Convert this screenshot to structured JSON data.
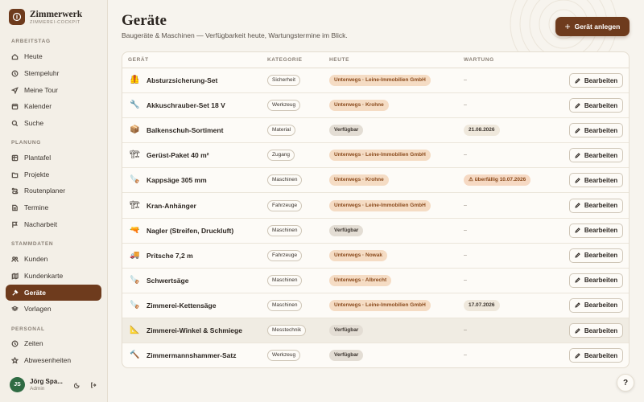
{
  "brand": {
    "name": "Zimmerwerk",
    "subtitle": "ZIMMEREI-COCKPIT"
  },
  "sidebar": {
    "sections": [
      "ARBEITSTAG",
      "PLANUNG",
      "STAMMDATEN",
      "PERSONAL"
    ],
    "items": [
      {
        "label": "Heute",
        "icon": "home-icon"
      },
      {
        "label": "Stempeluhr",
        "icon": "clock-icon"
      },
      {
        "label": "Meine Tour",
        "icon": "send-icon"
      },
      {
        "label": "Kalender",
        "icon": "calendar-icon"
      },
      {
        "label": "Suche",
        "icon": "search-icon"
      },
      {
        "label": "Plantafel",
        "icon": "grid-icon"
      },
      {
        "label": "Projekte",
        "icon": "folder-icon"
      },
      {
        "label": "Routenplaner",
        "icon": "route-icon"
      },
      {
        "label": "Termine",
        "icon": "document-icon"
      },
      {
        "label": "Nacharbeit",
        "icon": "flag-icon"
      },
      {
        "label": "Kunden",
        "icon": "users-icon"
      },
      {
        "label": "Kundenkarte",
        "icon": "map-icon"
      },
      {
        "label": "Geräte",
        "icon": "hammer-icon",
        "active": true
      },
      {
        "label": "Vorlagen",
        "icon": "layers-icon"
      },
      {
        "label": "Zeiten",
        "icon": "clock-icon"
      },
      {
        "label": "Abwesenheiten",
        "icon": "star-icon"
      }
    ]
  },
  "user": {
    "initials": "JS",
    "name": "Jörg Spa...",
    "role": "Admin"
  },
  "header": {
    "title": "Geräte",
    "subtitle": "Baugeräte & Maschinen — Verfügbarkeit heute, Wartungstermine im Blick.",
    "add_button": "Gerät anlegen"
  },
  "table": {
    "columns": [
      "GERÄT",
      "KATEGORIE",
      "HEUTE",
      "WARTUNG"
    ],
    "edit_label": "Bearbeiten",
    "rows": [
      {
        "icon": "🦺",
        "name": "Absturzsicherung-Set",
        "category": "Sicherheit",
        "status": "Unterwegs · Leine-Immobilien GmbH",
        "status_type": "away",
        "wartung": "–",
        "wartung_type": "none"
      },
      {
        "icon": "🔧",
        "name": "Akkuschrauber-Set 18 V",
        "category": "Werkzeug",
        "status": "Unterwegs · Krohne",
        "status_type": "away",
        "wartung": "–",
        "wartung_type": "none"
      },
      {
        "icon": "📦",
        "name": "Balkenschuh-Sortiment",
        "category": "Material",
        "status": "Verfügbar",
        "status_type": "free",
        "wartung": "21.08.2026",
        "wartung_type": "date"
      },
      {
        "icon": "🏗",
        "name": "Gerüst-Paket 40 m²",
        "category": "Zugang",
        "status": "Unterwegs · Leine-Immobilien GmbH",
        "status_type": "away",
        "wartung": "–",
        "wartung_type": "none"
      },
      {
        "icon": "🪚",
        "name": "Kappsäge 305 mm",
        "category": "Maschinen",
        "status": "Unterwegs · Krohne",
        "status_type": "away",
        "wartung": "⚠ überfällig 10.07.2026",
        "wartung_type": "due"
      },
      {
        "icon": "🏗",
        "name": "Kran-Anhänger",
        "category": "Fahrzeuge",
        "status": "Unterwegs · Leine-Immobilien GmbH",
        "status_type": "away",
        "wartung": "–",
        "wartung_type": "none"
      },
      {
        "icon": "🔫",
        "name": "Nagler (Streifen, Druckluft)",
        "category": "Maschinen",
        "status": "Verfügbar",
        "status_type": "free",
        "wartung": "–",
        "wartung_type": "none"
      },
      {
        "icon": "🚚",
        "name": "Pritsche 7,2 m",
        "category": "Fahrzeuge",
        "status": "Unterwegs · Nowak",
        "status_type": "away",
        "wartung": "–",
        "wartung_type": "none"
      },
      {
        "icon": "🪚",
        "name": "Schwertsäge",
        "category": "Maschinen",
        "status": "Unterwegs · Albrecht",
        "status_type": "away",
        "wartung": "–",
        "wartung_type": "none"
      },
      {
        "icon": "🪚",
        "name": "Zimmerei-Kettensäge",
        "category": "Maschinen",
        "status": "Unterwegs · Leine-Immobilien GmbH",
        "status_type": "away",
        "wartung": "17.07.2026",
        "wartung_type": "date"
      },
      {
        "icon": "📐",
        "name": "Zimmerei-Winkel & Schmiege",
        "category": "Messtechnik",
        "status": "Verfügbar",
        "status_type": "free",
        "wartung": "–",
        "wartung_type": "none"
      },
      {
        "icon": "🔨",
        "name": "Zimmermannshammer-Satz",
        "category": "Werkzeug",
        "status": "Verfügbar",
        "status_type": "free",
        "wartung": "–",
        "wartung_type": "none"
      }
    ]
  },
  "help_label": "?",
  "colors": {
    "accent": "#6e3b1d",
    "away_bg": "#f5dcc4",
    "free_bg": "#e3ddd4",
    "avatar": "#2f6b43"
  }
}
